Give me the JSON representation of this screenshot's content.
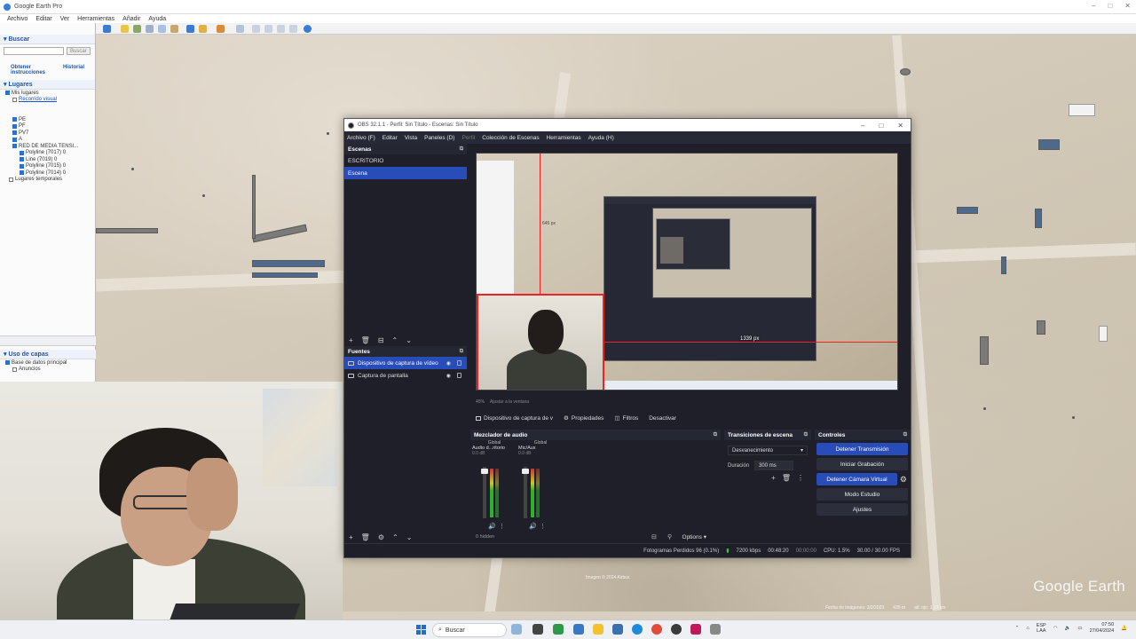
{
  "google_earth": {
    "window_title": "Google Earth Pro",
    "menu": [
      "Archivo",
      "Editar",
      "Ver",
      "Herramientas",
      "Añadir",
      "Ayuda"
    ],
    "search_header": "Buscar",
    "search_button": "Buscar",
    "links": [
      "Obtener instrucciones",
      "Historial"
    ],
    "places_header": "Lugares",
    "places_tree": [
      "Mis lugares",
      "Recorrido visual",
      "PE",
      "PF",
      "PV7",
      "A",
      "RED DE MEDIA TENSI...",
      "Polyline (7017) 0",
      "Line (7019) 0",
      "Polyline (7015) 0",
      "Polyline (7014) 0",
      "Lugares temporales"
    ],
    "layers_header": "Uso de capas",
    "layers_tree": [
      "Base de datos principal",
      "Anuncios"
    ],
    "watermark": "Google Earth",
    "image_credit": "Imagen © 2024 Airbus",
    "status_items": [
      "Fecha de imágenes: 3/2/2023",
      "435 m",
      "alt. ojo: 1,13 km"
    ]
  },
  "obs": {
    "window_title": "OBS 32.1.1 - Perfil: Sin Título - Escenas: Sin Título",
    "menu": [
      "Archivo (F)",
      "Editar",
      "Vista",
      "Paneles (D)",
      "Perfil",
      "Colección de Escenas",
      "Herramientas",
      "Ayuda (H)"
    ],
    "scenes_header": "Escenas",
    "scenes": [
      "ESCRITORIO",
      "Escena"
    ],
    "active_scene": "Escena",
    "sources_header": "Fuentes",
    "sources": [
      "Dispositivo de captura de vídeo",
      "Captura de pantalla"
    ],
    "preview_measure": "1339 px",
    "preview_measure_small": "645 px",
    "preview_zoom": "45%",
    "preview_fit": "Ajustar a la ventana",
    "context_bar": {
      "source_name": "Dispositivo de captura de v",
      "properties": "Propiedades",
      "filters": "Filtros",
      "deactivate": "Desactivar"
    },
    "mixer": {
      "header": "Mezclador de audio",
      "channels": [
        {
          "tag": "Global",
          "name": "Audio d...ritorio",
          "db": "0.0 dB"
        },
        {
          "tag": "Global",
          "name": "Mic/Aux",
          "db": "0.0 dB"
        }
      ],
      "hidden": "0 hidden",
      "options": "Options"
    },
    "transitions": {
      "header": "Transiciones de escena",
      "selected": "Desvanecimiento",
      "duration_label": "Duración",
      "duration_value": "300 ms"
    },
    "controls": {
      "header": "Controles",
      "stop_stream": "Detener Transmisión",
      "start_recording": "Iniciar Grabación",
      "stop_virtual_cam": "Detener Cámara Virtual",
      "studio_mode": "Modo Estudio",
      "settings": "Ajustes"
    },
    "status": {
      "dropped_frames": "Fotogramas Perdidos 96 (0.1%)",
      "bitrate": "7200 kbps",
      "live_time": "00:48:20",
      "rec_time": "00:00:00",
      "cpu": "CPU: 1.5%",
      "fps": "30.00 / 30.00 FPS"
    }
  },
  "taskbar": {
    "search_placeholder": "Buscar",
    "lang_top": "ESP",
    "lang_bottom": "LAA",
    "time": "07:50",
    "date": "27/04/2024"
  },
  "colors": {
    "obs_accent": "#284cb8",
    "obs_bg": "#1e1f29",
    "source_outline": "#e22222"
  }
}
